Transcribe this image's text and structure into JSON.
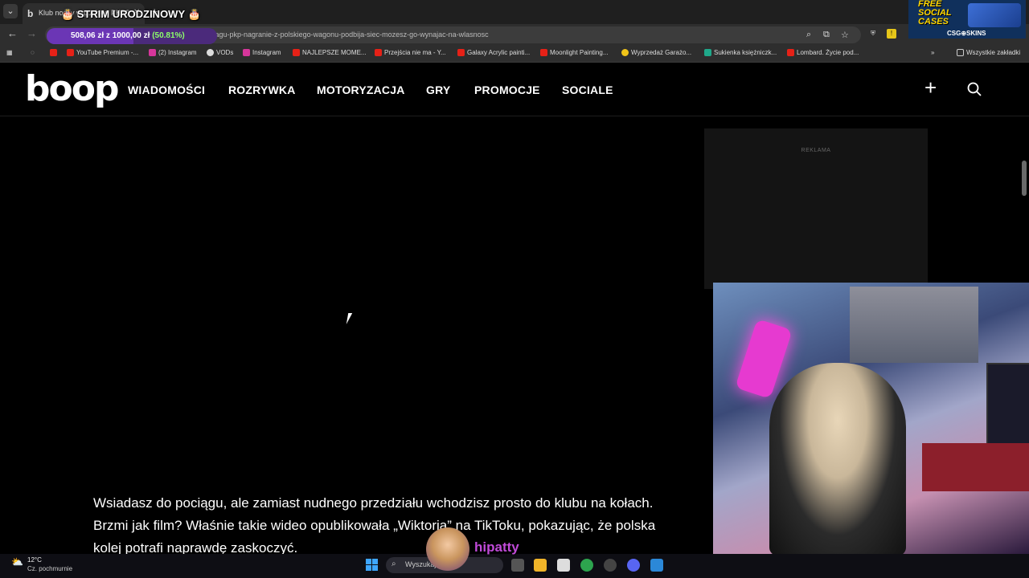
{
  "browser": {
    "tab_title": "Klub nocny w pociągu PKP? N...",
    "url": "pociagu-pkp-nagranie-z-polskiego-wagonu-podbija-siec-mozesz-go-wynajac-na-wlasnosc",
    "bookmarks": [
      "YouTube Premium -...",
      "(2) Instagram",
      "VODs",
      "Instagram",
      "NAJLEPSZE MOME...",
      "Przejścia nie ma - Y...",
      "Galaxy Acrylic painti...",
      "Moonlight Painting...",
      "Wyprzedaż Garażo...",
      "Sukienka księżniczk...",
      "Lombard. Życie pod..."
    ],
    "all_bookmarks": "Wszystkie zakładki"
  },
  "stream": {
    "title": "🎂 STRIM URODZINOWY 🎂",
    "goal_text": "508,06 zł z 1000,00 zł",
    "goal_pct": "(50.81%)",
    "goal_fraction": 0.5081,
    "ad_free": "FREE",
    "ad_social": "SOCIAL",
    "ad_cases": "CASES",
    "ad_brand": "CSG⊕SKINS",
    "chat_name": "hipatty"
  },
  "site": {
    "logo": "boop",
    "nav": [
      "WIADOMOŚCI",
      "ROZRYWKA",
      "MOTORYZACJA",
      "GRY",
      "PROMOCJE",
      "SOCIALE"
    ],
    "ad_label": "REKLAMA",
    "article_text": "Wsiadasz do pociągu, ale zamiast nudnego przedziału wchodzisz prosto do klubu na kołach. Brzmi jak film? Właśnie takie wideo opublikowała „Wiktoria” na TikToku, pokazując, że polska kolej potrafi naprawdę zaskoczyć."
  },
  "taskbar": {
    "temp": "12°C",
    "weather": "Cz. pochmurnie",
    "search_placeholder": "Wyszukaj"
  }
}
